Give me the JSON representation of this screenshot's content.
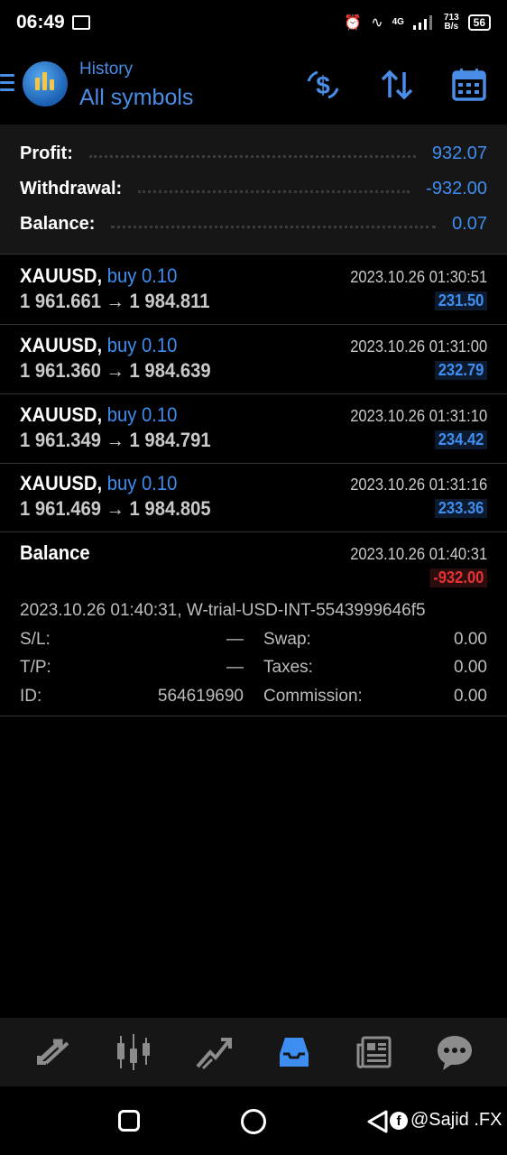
{
  "status_bar": {
    "time": "06:49",
    "network_type": "4G",
    "net_speed_value": "713",
    "net_speed_unit": "B/s",
    "battery": "56"
  },
  "header": {
    "subtitle": "History",
    "title": "All symbols",
    "accent_color": "#4a8de6"
  },
  "summary": {
    "profit_label": "Profit:",
    "profit_value": "932.07",
    "withdrawal_label": "Withdrawal:",
    "withdrawal_value": "-932.00",
    "balance_label": "Balance:",
    "balance_value": "0.07"
  },
  "trades": [
    {
      "symbol": "XAUUSD,",
      "side": "buy 0.10",
      "open": "1 961.661",
      "arrow": "→",
      "close": "1 984.811",
      "time": "2023.10.26 01:30:51",
      "profit": "231.50"
    },
    {
      "symbol": "XAUUSD,",
      "side": "buy 0.10",
      "open": "1 961.360",
      "arrow": "→",
      "close": "1 984.639",
      "time": "2023.10.26 01:31:00",
      "profit": "232.79"
    },
    {
      "symbol": "XAUUSD,",
      "side": "buy 0.10",
      "open": "1 961.349",
      "arrow": "→",
      "close": "1 984.791",
      "time": "2023.10.26 01:31:10",
      "profit": "234.42"
    },
    {
      "symbol": "XAUUSD,",
      "side": "buy 0.10",
      "open": "1 961.469",
      "arrow": "→",
      "close": "1 984.805",
      "time": "2023.10.26 01:31:16",
      "profit": "233.36"
    }
  ],
  "balance_op": {
    "title": "Balance",
    "time": "2023.10.26 01:40:31",
    "amount": "-932.00",
    "comment": "2023.10.26 01:40:31, W-trial-USD-INT-5543999646f5",
    "sl_label": "S/L:",
    "sl_value": "—",
    "swap_label": "Swap:",
    "swap_value": "0.00",
    "tp_label": "T/P:",
    "tp_value": "—",
    "taxes_label": "Taxes:",
    "taxes_value": "0.00",
    "id_label": "ID:",
    "id_value": "564619690",
    "commission_label": "Commission:",
    "commission_value": "0.00"
  },
  "bottom_nav": [
    {
      "icon": "quotes-arrows-icon"
    },
    {
      "icon": "chart-candles-icon"
    },
    {
      "icon": "trade-line-icon"
    },
    {
      "icon": "history-inbox-icon",
      "active": true
    },
    {
      "icon": "news-icon"
    },
    {
      "icon": "chat-icon"
    }
  ],
  "watermark": "@Sajid .FX",
  "colors": {
    "positive": "#3d8ef0",
    "negative": "#e63232"
  }
}
